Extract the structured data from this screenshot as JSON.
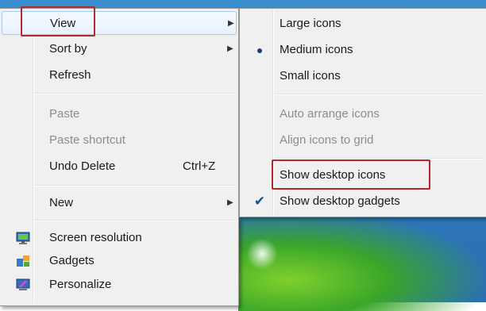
{
  "context_menu": {
    "items": [
      {
        "label": "View",
        "has_submenu": true,
        "highlighted": true
      },
      {
        "label": "Sort by",
        "has_submenu": true
      },
      {
        "label": "Refresh"
      },
      {
        "label": "Paste",
        "disabled": true
      },
      {
        "label": "Paste shortcut",
        "disabled": true
      },
      {
        "label": "Undo Delete",
        "shortcut": "Ctrl+Z"
      },
      {
        "label": "New",
        "has_submenu": true
      },
      {
        "label": "Screen resolution",
        "icon": "monitor-icon"
      },
      {
        "label": "Gadgets",
        "icon": "gadgets-icon"
      },
      {
        "label": "Personalize",
        "icon": "personalize-icon"
      }
    ]
  },
  "view_submenu": {
    "items": [
      {
        "label": "Large icons"
      },
      {
        "label": "Medium icons",
        "selected_radio": true
      },
      {
        "label": "Small icons"
      },
      {
        "label": "Auto arrange icons",
        "disabled": true
      },
      {
        "label": "Align icons to grid",
        "disabled": true
      },
      {
        "label": "Show desktop icons",
        "checked": false
      },
      {
        "label": "Show desktop gadgets",
        "checked": true
      }
    ]
  },
  "annotations": {
    "highlight_color": "#b22a2a"
  }
}
